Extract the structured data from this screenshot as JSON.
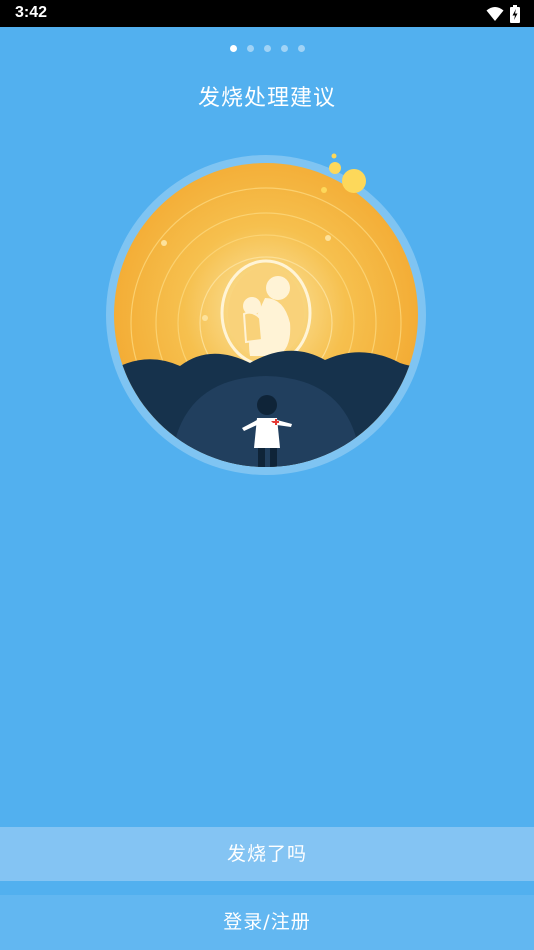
{
  "status_bar": {
    "time": "3:42",
    "icons": [
      "wifi-icon",
      "battery-charging-icon"
    ]
  },
  "pager": {
    "total": 5,
    "active_index": 0
  },
  "page": {
    "title": "发烧处理建议"
  },
  "illustration": {
    "description_icon": "mother-child-doctor-illustration"
  },
  "buttons": {
    "primary_label": "发烧了吗",
    "secondary_label": "登录/注册"
  },
  "colors": {
    "background": "#52b0ef",
    "primary_button": "#84c4f3",
    "secondary_button": "#62b7f1",
    "sun": "#f5ae35",
    "hills": "#1d3a55"
  }
}
